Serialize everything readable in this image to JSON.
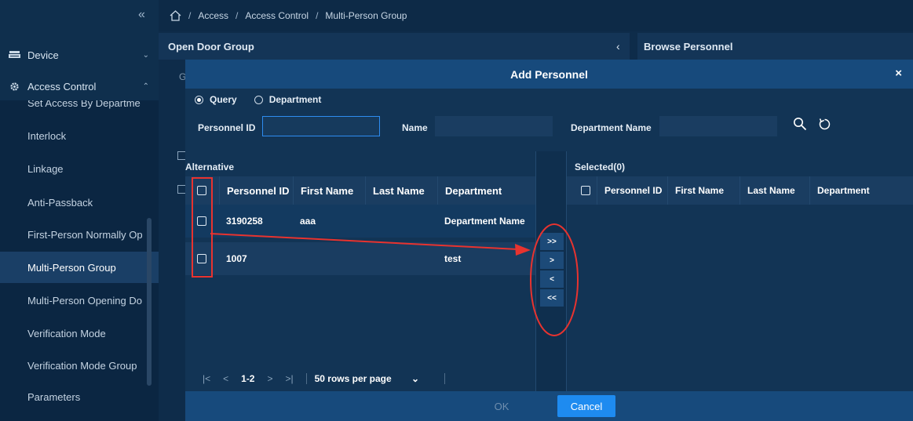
{
  "sidebar": {
    "collapse_glyph": "«",
    "menus": [
      {
        "label": "Device",
        "icon": "device-icon",
        "chevron": "⌄"
      },
      {
        "label": "Access Control",
        "icon": "gear-icon",
        "chevron": "⌃"
      }
    ],
    "items": [
      {
        "label": "Set Access By Departme",
        "active": false
      },
      {
        "label": "Interlock",
        "active": false
      },
      {
        "label": "Linkage",
        "active": false
      },
      {
        "label": "Anti-Passback",
        "active": false
      },
      {
        "label": "First-Person Normally Op",
        "active": false
      },
      {
        "label": "Multi-Person Group",
        "active": true
      },
      {
        "label": "Multi-Person Opening Do",
        "active": false
      },
      {
        "label": "Verification Mode",
        "active": false
      },
      {
        "label": "Verification Mode Group",
        "active": false
      },
      {
        "label": "Parameters",
        "active": false
      }
    ]
  },
  "breadcrumb": {
    "items": [
      "Access",
      "Access Control",
      "Multi-Person Group"
    ],
    "separator": "/"
  },
  "background": {
    "open_door_group": "Open Door Group",
    "browse_personnel": "Browse Personnel",
    "browse_chevron": "‹",
    "col_initial": "G"
  },
  "dialog": {
    "title": "Add Personnel",
    "close": "×",
    "radio": {
      "query": "Query",
      "department": "Department",
      "selected": "query"
    },
    "filters": {
      "personnel_id_label": "Personnel ID",
      "personnel_id_value": "",
      "name_label": "Name",
      "name_value": "",
      "department_label": "Department Name",
      "department_value": ""
    },
    "alternative": {
      "title": "Alternative",
      "columns": [
        "Personnel ID",
        "First Name",
        "Last Name",
        "Department"
      ],
      "rows": [
        {
          "id": "3190258",
          "first": "aaa",
          "last": "",
          "dept": "Department Name"
        },
        {
          "id": "1007",
          "first": "",
          "last": "",
          "dept": "test"
        }
      ]
    },
    "selected": {
      "title": "Selected(0)",
      "columns": [
        "Personnel ID",
        "First Name",
        "Last Name",
        "Department"
      ]
    },
    "transfer": [
      ">>",
      ">",
      "<",
      "<<"
    ],
    "pager": {
      "first": "|<",
      "prev": "<",
      "range": "1-2",
      "next": ">",
      "last": ">|",
      "rows_per_page": "50 rows per page",
      "rows_chevron": "⌄"
    },
    "footer": {
      "ok": "OK",
      "cancel": "Cancel"
    }
  },
  "colors": {
    "accent": "#1e8bf0",
    "header": "#174a7c",
    "annotation": "#e8332f"
  }
}
